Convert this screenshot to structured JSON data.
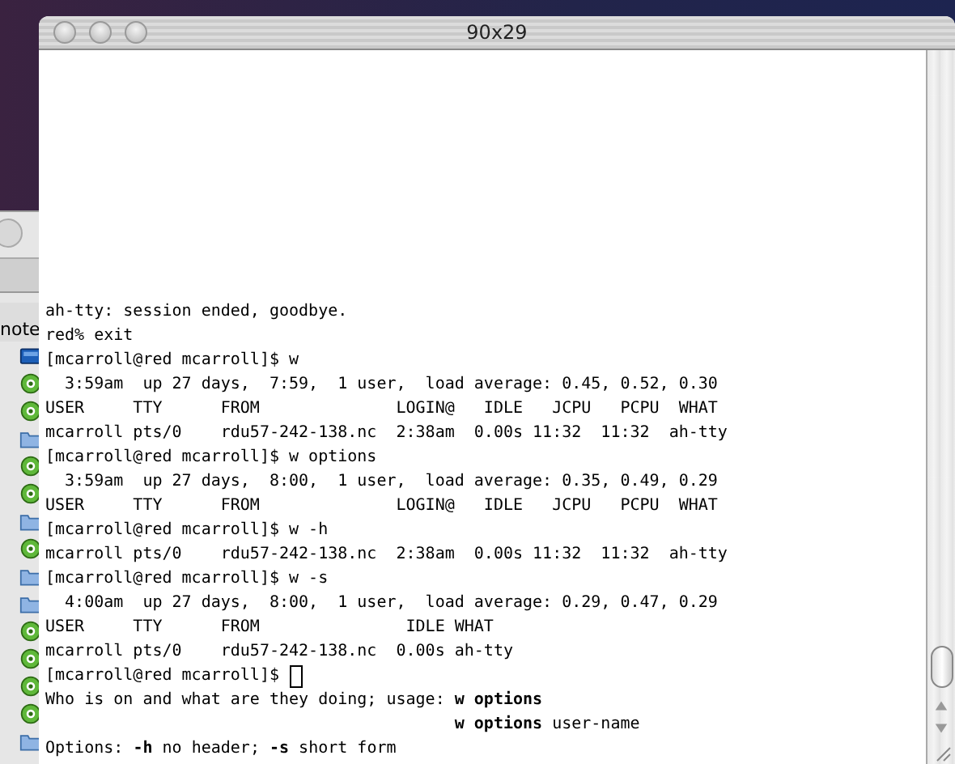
{
  "back_window": {
    "label": "note",
    "icons": [
      {
        "kind": "disk"
      },
      {
        "kind": "app"
      },
      {
        "kind": "app"
      },
      {
        "kind": "folder"
      },
      {
        "kind": "app"
      },
      {
        "kind": "app"
      },
      {
        "kind": "folder"
      },
      {
        "kind": "app"
      },
      {
        "kind": "folder"
      },
      {
        "kind": "folder"
      },
      {
        "kind": "app"
      },
      {
        "kind": "app"
      },
      {
        "kind": "app"
      },
      {
        "kind": "app"
      },
      {
        "kind": "folder"
      }
    ]
  },
  "window": {
    "title": "90x29"
  },
  "terminal_lines": [
    {
      "text": "ah-tty: session ended, goodbye.",
      "cursor": false
    },
    {
      "text": "red% exit",
      "cursor": false
    },
    {
      "text": "[mcarroll@red mcarroll]$ w",
      "cursor": false
    },
    {
      "text": "  3:59am  up 27 days,  7:59,  1 user,  load average: 0.45, 0.52, 0.30",
      "cursor": false
    },
    {
      "text": "USER     TTY      FROM              LOGIN@   IDLE   JCPU   PCPU  WHAT",
      "cursor": false
    },
    {
      "text": "mcarroll pts/0    rdu57-242-138.nc  2:38am  0.00s 11:32  11:32  ah-tty",
      "cursor": false
    },
    {
      "text": "[mcarroll@red mcarroll]$ w options",
      "cursor": false
    },
    {
      "text": "  3:59am  up 27 days,  8:00,  1 user,  load average: 0.35, 0.49, 0.29",
      "cursor": false
    },
    {
      "text": "USER     TTY      FROM              LOGIN@   IDLE   JCPU   PCPU  WHAT",
      "cursor": false
    },
    {
      "text": "[mcarroll@red mcarroll]$ w -h",
      "cursor": false
    },
    {
      "text": "mcarroll pts/0    rdu57-242-138.nc  2:38am  0.00s 11:32  11:32  ah-tty",
      "cursor": false
    },
    {
      "text": "[mcarroll@red mcarroll]$ w -s",
      "cursor": false
    },
    {
      "text": "  4:00am  up 27 days,  8:00,  1 user,  load average: 0.29, 0.47, 0.29",
      "cursor": false
    },
    {
      "text": "USER     TTY      FROM               IDLE WHAT",
      "cursor": false
    },
    {
      "text": "mcarroll pts/0    rdu57-242-138.nc  0.00s ah-tty",
      "cursor": false
    },
    {
      "text": "[mcarroll@red mcarroll]$",
      "cursor": true
    },
    {
      "text": "Who is on and what are they doing; usage: **w options**",
      "cursor": false
    },
    {
      "text": "                                          **w options** user-name",
      "cursor": false
    },
    {
      "text": "Options: **-h** no header; **-s** short form",
      "cursor": false
    }
  ]
}
